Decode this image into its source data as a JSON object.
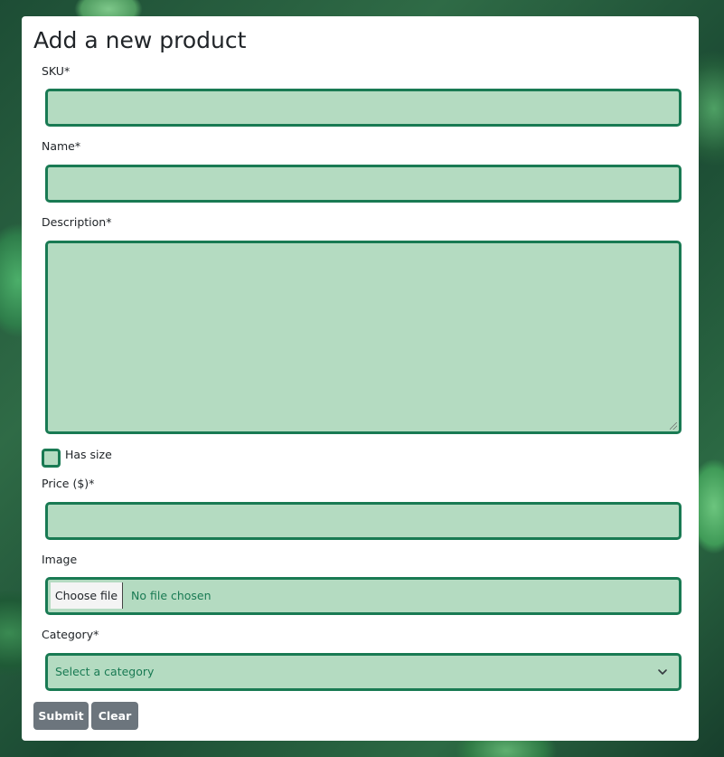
{
  "form": {
    "title": "Add a new product",
    "sku": {
      "label": "SKU*",
      "value": ""
    },
    "name": {
      "label": "Name*",
      "value": ""
    },
    "description": {
      "label": "Description*",
      "value": ""
    },
    "has_size": {
      "label": "Has size",
      "checked": false
    },
    "price": {
      "label": "Price ($)*",
      "value": ""
    },
    "image": {
      "label": "Image",
      "button_label": "Choose file",
      "status": "No file chosen"
    },
    "category": {
      "label": "Category*",
      "selected": "Select a category"
    },
    "submit_label": "Submit",
    "clear_label": "Clear"
  },
  "colors": {
    "field_background": "#b4dbc1",
    "field_border": "#197a53",
    "button_background": "#6c757d"
  }
}
